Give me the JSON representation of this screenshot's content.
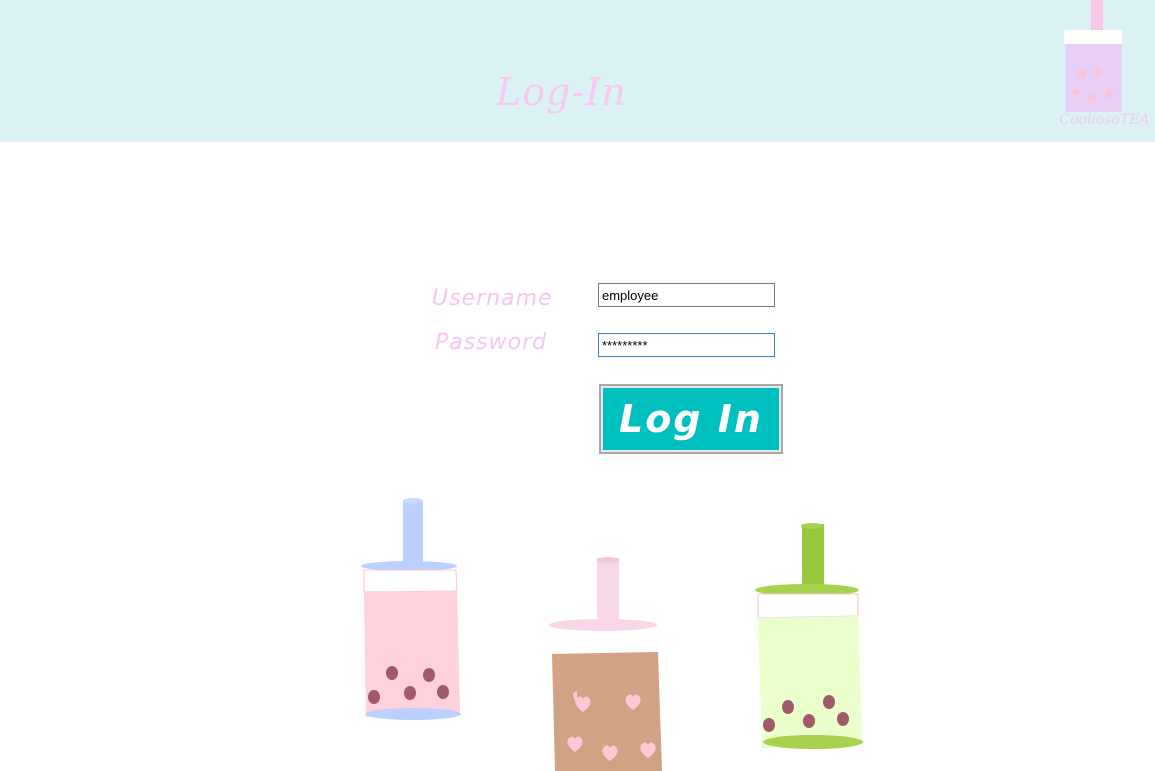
{
  "header": {
    "title": "Log-In",
    "logo_text": "CooliosoTEA",
    "background": "#daf2f3",
    "title_color": "#f7c7f4"
  },
  "form": {
    "username_label": "Username",
    "password_label": "Password",
    "username_value": "employee",
    "password_value": "*********",
    "login_button_label": "Log In",
    "button_color": "#00bfbf",
    "label_color": "#f6c6f2"
  },
  "illustration": {
    "drinks": [
      {
        "name": "strawberry-boba-icon",
        "cup": "#ffd1dc",
        "straw": "#bcd0ff",
        "pearls": "#a05a6a"
      },
      {
        "name": "milk-tea-heart-boba-icon",
        "cup": "#d2a285",
        "straw": "#f7d6e8",
        "pearls": "#ffc8d8"
      },
      {
        "name": "matcha-boba-icon",
        "cup": "#eaffcc",
        "straw": "#96c83c",
        "pearls": "#a05a6a"
      }
    ]
  }
}
